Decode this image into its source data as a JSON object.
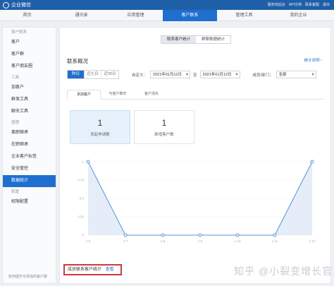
{
  "topbar": {
    "brand": "企业微信",
    "links": [
      "服务商后台",
      "API文档",
      "联系客服",
      "退出"
    ]
  },
  "nav": [
    "首页",
    "通讯录",
    "应用管理",
    "客户联系",
    "管理工具",
    "我的企业"
  ],
  "nav_active_index": 3,
  "sidebar": {
    "groups": [
      {
        "title": "客户联系",
        "items": [
          "客户",
          "客户群",
          "客户朋友圈"
        ]
      },
      {
        "title": "工具",
        "items": [
          "加客户",
          "群发工具",
          "聊天工具"
        ]
      },
      {
        "title": "管理",
        "items": [
          "离职继承",
          "在职继承",
          "企业客户标签",
          "安全管控",
          "数据统计"
        ]
      },
      {
        "title": "配置",
        "items": [
          "权限配置"
        ]
      }
    ],
    "active_item": "数据统计",
    "footer": "如何提升可添加的客户数"
  },
  "segment": {
    "tabs": [
      "联系客户统计",
      "群聊数据统计"
    ],
    "active": 0
  },
  "section_title": "联系概况",
  "help_link": "统计说明",
  "filters": {
    "ranges": [
      "昨日",
      "近七日",
      "近30日"
    ],
    "range_active": 0,
    "custom_label": "自定义：",
    "start_date": "2021年01月12日",
    "to": "至",
    "end_date": "2021年01月12日",
    "member_label": "成员/部门：",
    "member_value": "全部"
  },
  "subtabs": {
    "items": [
      "添加客户",
      "与客户聊天",
      "客户流失"
    ],
    "active": 0
  },
  "cards": [
    {
      "value": "1",
      "label": "发起申请数",
      "active": true
    },
    {
      "value": "1",
      "label": "新增客户数",
      "active": false
    }
  ],
  "chart_data": {
    "type": "area",
    "x": [
      "1-6",
      "1-7",
      "1-8",
      "1-9",
      "1-10",
      "1-11",
      "1-12"
    ],
    "values": [
      1,
      0,
      0,
      0,
      0,
      0,
      1
    ],
    "ylim": [
      0,
      1
    ],
    "yticks": [
      "1",
      "0.75",
      "0.5",
      "0.25",
      "0"
    ],
    "grid": true,
    "color": "#5b8fd6"
  },
  "bottom_link": {
    "text": "成员联系客户统计",
    "view": "查看"
  },
  "watermark": "知乎 @小裂变增长官"
}
